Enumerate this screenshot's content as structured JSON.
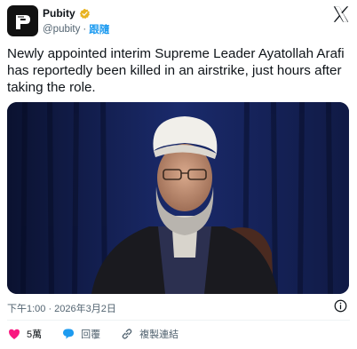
{
  "author": {
    "display_name": "Pubity",
    "handle": "@pubity",
    "separator": "·",
    "follow_label": "跟隨",
    "verified_color": "#e8b321"
  },
  "tweet": {
    "text": "Newly appointed interim Supreme Leader Ayatollah Arafi has reportedly been killed in an airstrike, just hours after taking the role.",
    "timestamp": "下午1:00 · 2026年3月2日"
  },
  "actions": {
    "like_count": "5萬",
    "reply_label": "回覆",
    "copy_link_label": "複製連結",
    "like_color": "#f91880",
    "reply_color": "#1d9bf0"
  },
  "icons": [
    "pubity-logo-icon",
    "verified-badge-icon",
    "close-icon",
    "info-icon",
    "heart-icon",
    "reply-icon",
    "link-icon"
  ]
}
